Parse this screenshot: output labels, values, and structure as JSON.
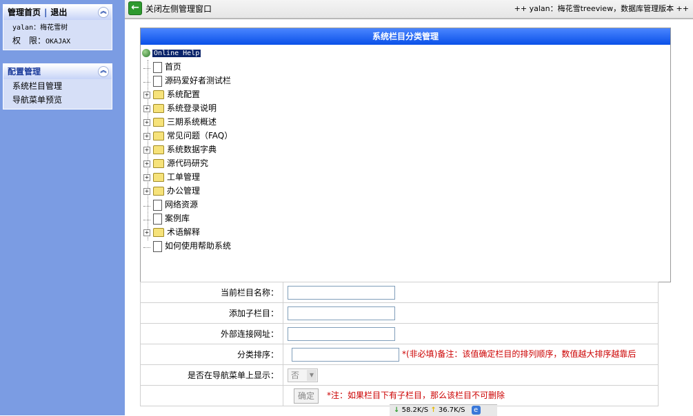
{
  "sidebar": {
    "panel1": {
      "home_link": "管理首页",
      "separator": "|",
      "logout_link": "退出",
      "user_line": "yalan：梅花雪树",
      "perm_label": "权　限：",
      "perm_value": "OKAJAX"
    },
    "panel2": {
      "title": "配置管理",
      "items": [
        "系统栏目管理",
        "导航菜单预览"
      ]
    }
  },
  "topbar": {
    "close_left": "关闭左侧管理窗口",
    "right_text": "++ yalan：梅花雪treeview，数据库管理版本 ++"
  },
  "tree": {
    "title": "系统栏目分类管理",
    "root": "Online Help",
    "items": [
      {
        "label": "首页",
        "type": "doc"
      },
      {
        "label": "源码爱好者测试栏",
        "type": "doc"
      },
      {
        "label": "系统配置",
        "type": "folder"
      },
      {
        "label": "系统登录说明",
        "type": "folder"
      },
      {
        "label": "三期系统概述",
        "type": "folder"
      },
      {
        "label": "常见问题（FAQ）",
        "type": "folder"
      },
      {
        "label": "系统数据字典",
        "type": "folder"
      },
      {
        "label": "源代码研究",
        "type": "folder"
      },
      {
        "label": "工单管理",
        "type": "folder"
      },
      {
        "label": "办公管理",
        "type": "folder"
      },
      {
        "label": "网络资源",
        "type": "doc"
      },
      {
        "label": "案例库",
        "type": "doc"
      },
      {
        "label": "术语解释",
        "type": "folder"
      },
      {
        "label": "如何使用帮助系统",
        "type": "doc"
      }
    ]
  },
  "form": {
    "current_name_label": "当前栏目名称：",
    "current_name_value": "",
    "add_child_label": "添加子栏目：",
    "add_child_value": "",
    "external_url_label": "外部连接网址：",
    "external_url_value": "",
    "sort_label": "分类排序：",
    "sort_value": "",
    "sort_note": "*(非必填)备注：该值确定栏目的排列顺序，数值越大排序越靠后",
    "show_nav_label": "是否在导航菜单上显示：",
    "show_nav_value": "否",
    "confirm_button": "确定",
    "delete_note": "*注：如果栏目下有子栏目，那么该栏目不可删除"
  },
  "statusbar": {
    "down_speed": "58.2K/S",
    "up_speed": "36.7K/S"
  }
}
